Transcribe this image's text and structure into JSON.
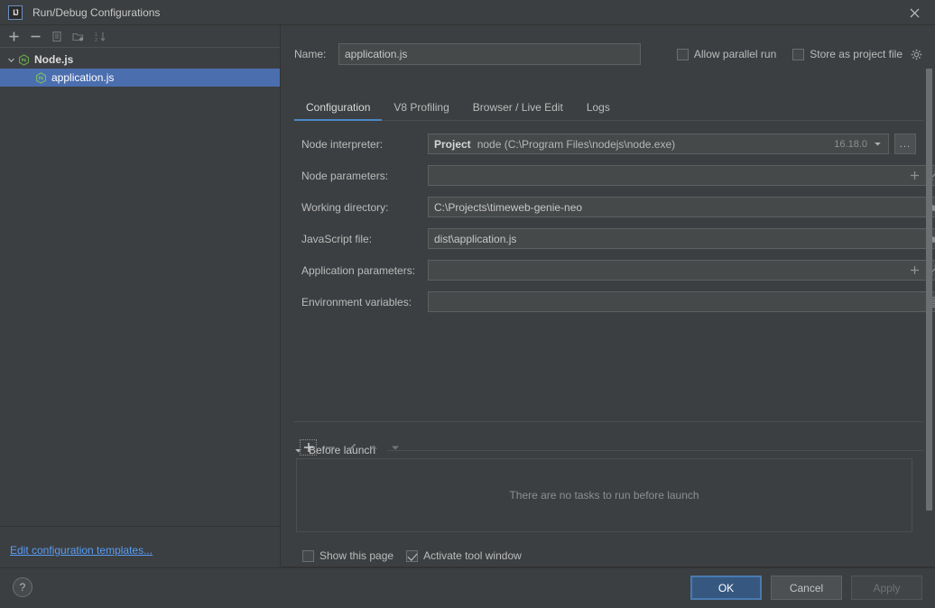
{
  "window": {
    "title": "Run/Debug Configurations",
    "logo_text": "IJ",
    "close_label": "✕"
  },
  "left_panel": {
    "toolbar": [
      {
        "name": "add-configuration-button",
        "glyph": "+",
        "enabled": true
      },
      {
        "name": "remove-configuration-button",
        "glyph": "−",
        "enabled": true
      },
      {
        "name": "copy-configuration-button",
        "glyph": "copy-icon",
        "enabled": false
      },
      {
        "name": "new-folder-button",
        "glyph": "folder-add-icon",
        "enabled": false
      },
      {
        "name": "sort-configurations-button",
        "glyph": "sort-icon",
        "enabled": false
      }
    ],
    "tree": [
      {
        "label": "Node.js",
        "type": "group",
        "expanded": true,
        "icon": "nodejs-icon"
      },
      {
        "label": "application.js",
        "type": "child",
        "selected": true,
        "icon": "nodejs-icon"
      }
    ],
    "edit_templates_link": "Edit configuration templates..."
  },
  "form": {
    "name_label": "Name:",
    "name_value": "application.js",
    "allow_parallel_run": {
      "label": "Allow parallel run",
      "checked": false
    },
    "store_as_project_file": {
      "label": "Store as project file",
      "checked": false,
      "gear_icon": "gear-icon"
    }
  },
  "tabs": [
    {
      "label": "Configuration",
      "active": true
    },
    {
      "label": "V8 Profiling",
      "active": false
    },
    {
      "label": "Browser / Live Edit",
      "active": false
    },
    {
      "label": "Logs",
      "active": false
    }
  ],
  "fields": {
    "node_interpreter": {
      "label": "Node interpreter:",
      "prefix": "Project",
      "value": "node (C:\\Program Files\\nodejs\\node.exe)",
      "version": "16.18.0",
      "dropdown_icon": "chevron-down-icon",
      "browse_label": "..."
    },
    "node_parameters": {
      "label": "Node parameters:",
      "value": "",
      "icons": [
        "plus-icon",
        "expand-icon"
      ]
    },
    "working_directory": {
      "label": "Working directory:",
      "value": "C:\\Projects\\timeweb-genie-neo",
      "icons": [
        "folder-icon"
      ]
    },
    "javascript_file": {
      "label": "JavaScript file:",
      "value": "dist\\application.js",
      "icons": [
        "folder-icon"
      ]
    },
    "application_parameters": {
      "label": "Application parameters:",
      "value": "",
      "icons": [
        "plus-icon",
        "expand-icon"
      ]
    },
    "environment_variables": {
      "label": "Environment variables:",
      "value": "",
      "icons": [
        "list-icon"
      ]
    }
  },
  "before_launch": {
    "title": "Before launch",
    "toolbar": [
      {
        "name": "add-task-button",
        "glyph": "+",
        "enabled": true,
        "focused": true
      },
      {
        "name": "remove-task-button",
        "glyph": "−",
        "enabled": false
      },
      {
        "name": "edit-task-button",
        "glyph": "pencil-icon",
        "enabled": false
      },
      {
        "name": "move-task-up-button",
        "glyph": "arrow-up-icon",
        "enabled": false
      },
      {
        "name": "move-task-down-button",
        "glyph": "arrow-down-icon",
        "enabled": false
      }
    ],
    "empty_text": "There are no tasks to run before launch",
    "show_this_page": {
      "label": "Show this page",
      "checked": false
    },
    "activate_tool_window": {
      "label": "Activate tool window",
      "checked": true
    }
  },
  "footer": {
    "help_label": "?",
    "ok_label": "OK",
    "cancel_label": "Cancel",
    "apply_label": "Apply"
  },
  "colors": {
    "accent_blue": "#4b6eaf",
    "link_blue": "#589df6",
    "tab_underline": "#4a88c7",
    "primary_button": "#365880",
    "nodejs_green": "#6aa84f",
    "panel_bg": "#3c3f41",
    "field_bg": "#45494a"
  }
}
